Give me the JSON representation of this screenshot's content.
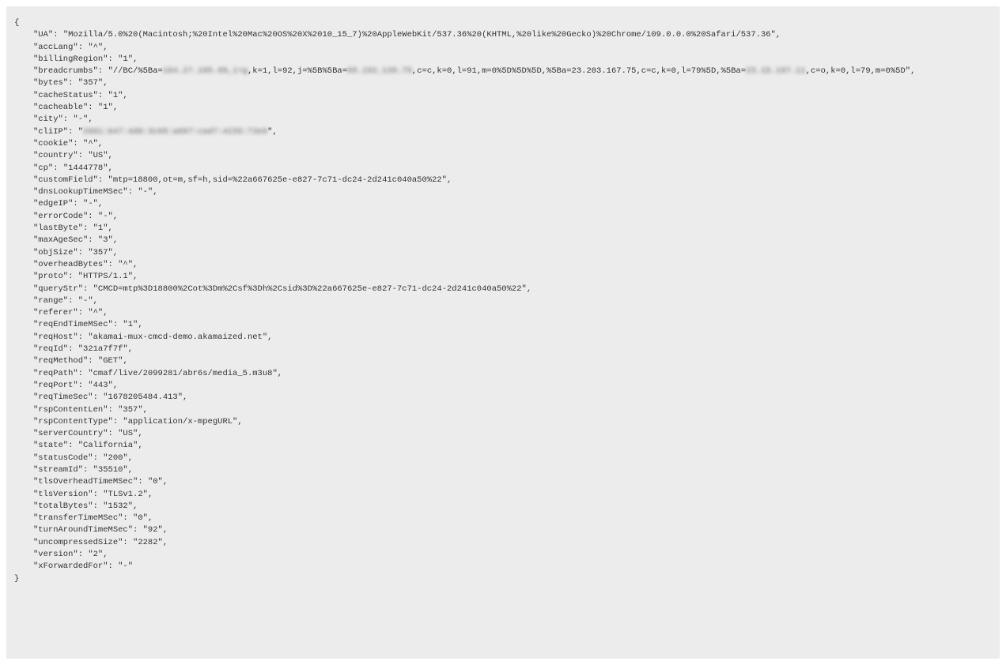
{
  "json_display": {
    "open_brace": "{",
    "close_brace": "}",
    "entries": [
      {
        "key": "UA",
        "value": "Mozilla/5.0%20(Macintosh;%20Intel%20Mac%20OS%20X%2010_15_7)%20AppleWebKit/537.36%20(KHTML,%20like%20Gecko)%20Chrome/109.0.0.0%20Safari/537.36",
        "comma": true
      },
      {
        "key": "accLang",
        "value": "^",
        "comma": true
      },
      {
        "key": "billingRegion",
        "value": "1",
        "comma": true
      },
      {
        "key": "breadcrumbs",
        "segments": [
          {
            "text": "//BC/%5Ba=",
            "blur": false
          },
          {
            "text": "104.27.195.99,i=g",
            "blur": true
          },
          {
            "text": ",k=1,l=92,j=%5B%5Ba=",
            "blur": false
          },
          {
            "text": "69.192.139.75",
            "blur": true
          },
          {
            "text": ",c=c,k=0,l=91,m=0%5D%5D%5D,%5Ba=23.203.167.75,c=c,k=0,l=79%5D,%5Ba=",
            "blur": false
          },
          {
            "text": "23.15.197.11",
            "blur": true
          },
          {
            "text": ",c=o,k=0,l=79,m=0%5D",
            "blur": false
          }
        ],
        "comma": true
      },
      {
        "key": "bytes",
        "value": "357",
        "comma": true
      },
      {
        "key": "cacheStatus",
        "value": "1",
        "comma": true
      },
      {
        "key": "cacheable",
        "value": "1",
        "comma": true
      },
      {
        "key": "city",
        "value": "-",
        "comma": true
      },
      {
        "key": "cliIP",
        "segments": [
          {
            "text": "2601:647:4d0:3c05:a097:cad7:4235:73e6",
            "blur": true
          }
        ],
        "comma": true
      },
      {
        "key": "cookie",
        "value": "^",
        "comma": true
      },
      {
        "key": "country",
        "value": "US",
        "comma": true
      },
      {
        "key": "cp",
        "value": "1444778",
        "comma": true
      },
      {
        "key": "customField",
        "value": "mtp=18800,ot=m,sf=h,sid=%22a667625e-e827-7c71-dc24-2d241c040a50%22",
        "comma": true
      },
      {
        "key": "dnsLookupTimeMSec",
        "value": "-",
        "comma": true
      },
      {
        "key": "edgeIP",
        "value": "-",
        "comma": true
      },
      {
        "key": "errorCode",
        "value": "-",
        "comma": true
      },
      {
        "key": "lastByte",
        "value": "1",
        "comma": true
      },
      {
        "key": "maxAgeSec",
        "value": "3",
        "comma": true
      },
      {
        "key": "objSize",
        "value": "357",
        "comma": true
      },
      {
        "key": "overheadBytes",
        "value": "^",
        "comma": true
      },
      {
        "key": "proto",
        "value": "HTTPS/1.1",
        "comma": true
      },
      {
        "key": "queryStr",
        "value": "CMCD=mtp%3D18800%2Cot%3Dm%2Csf%3Dh%2Csid%3D%22a667625e-e827-7c71-dc24-2d241c040a50%22",
        "comma": true
      },
      {
        "key": "range",
        "value": "-",
        "comma": true
      },
      {
        "key": "referer",
        "value": "^",
        "comma": true
      },
      {
        "key": "reqEndTimeMSec",
        "value": "1",
        "comma": true
      },
      {
        "key": "reqHost",
        "value": "akamai-mux-cmcd-demo.akamaized.net",
        "comma": true
      },
      {
        "key": "reqId",
        "value": "321a7f7f",
        "comma": true
      },
      {
        "key": "reqMethod",
        "value": "GET",
        "comma": true
      },
      {
        "key": "reqPath",
        "value": "cmaf/live/2099281/abr6s/media_5.m3u8",
        "comma": true
      },
      {
        "key": "reqPort",
        "value": "443",
        "comma": true
      },
      {
        "key": "reqTimeSec",
        "value": "1678205484.413",
        "comma": true
      },
      {
        "key": "rspContentLen",
        "value": "357",
        "comma": true
      },
      {
        "key": "rspContentType",
        "value": "application/x-mpegURL",
        "comma": true
      },
      {
        "key": "serverCountry",
        "value": "US",
        "comma": true
      },
      {
        "key": "state",
        "value": "California",
        "comma": true
      },
      {
        "key": "statusCode",
        "value": "200",
        "comma": true
      },
      {
        "key": "streamId",
        "value": "35510",
        "comma": true
      },
      {
        "key": "tlsOverheadTimeMSec",
        "value": "0",
        "comma": true
      },
      {
        "key": "tlsVersion",
        "value": "TLSv1.2",
        "comma": true
      },
      {
        "key": "totalBytes",
        "value": "1532",
        "comma": true
      },
      {
        "key": "transferTimeMSec",
        "value": "0",
        "comma": true
      },
      {
        "key": "turnAroundTimeMSec",
        "value": "92",
        "comma": true
      },
      {
        "key": "uncompressedSize",
        "value": "2282",
        "comma": true
      },
      {
        "key": "version",
        "value": "2",
        "comma": true
      },
      {
        "key": "xForwardedFor",
        "value": "-",
        "comma": false
      }
    ]
  }
}
